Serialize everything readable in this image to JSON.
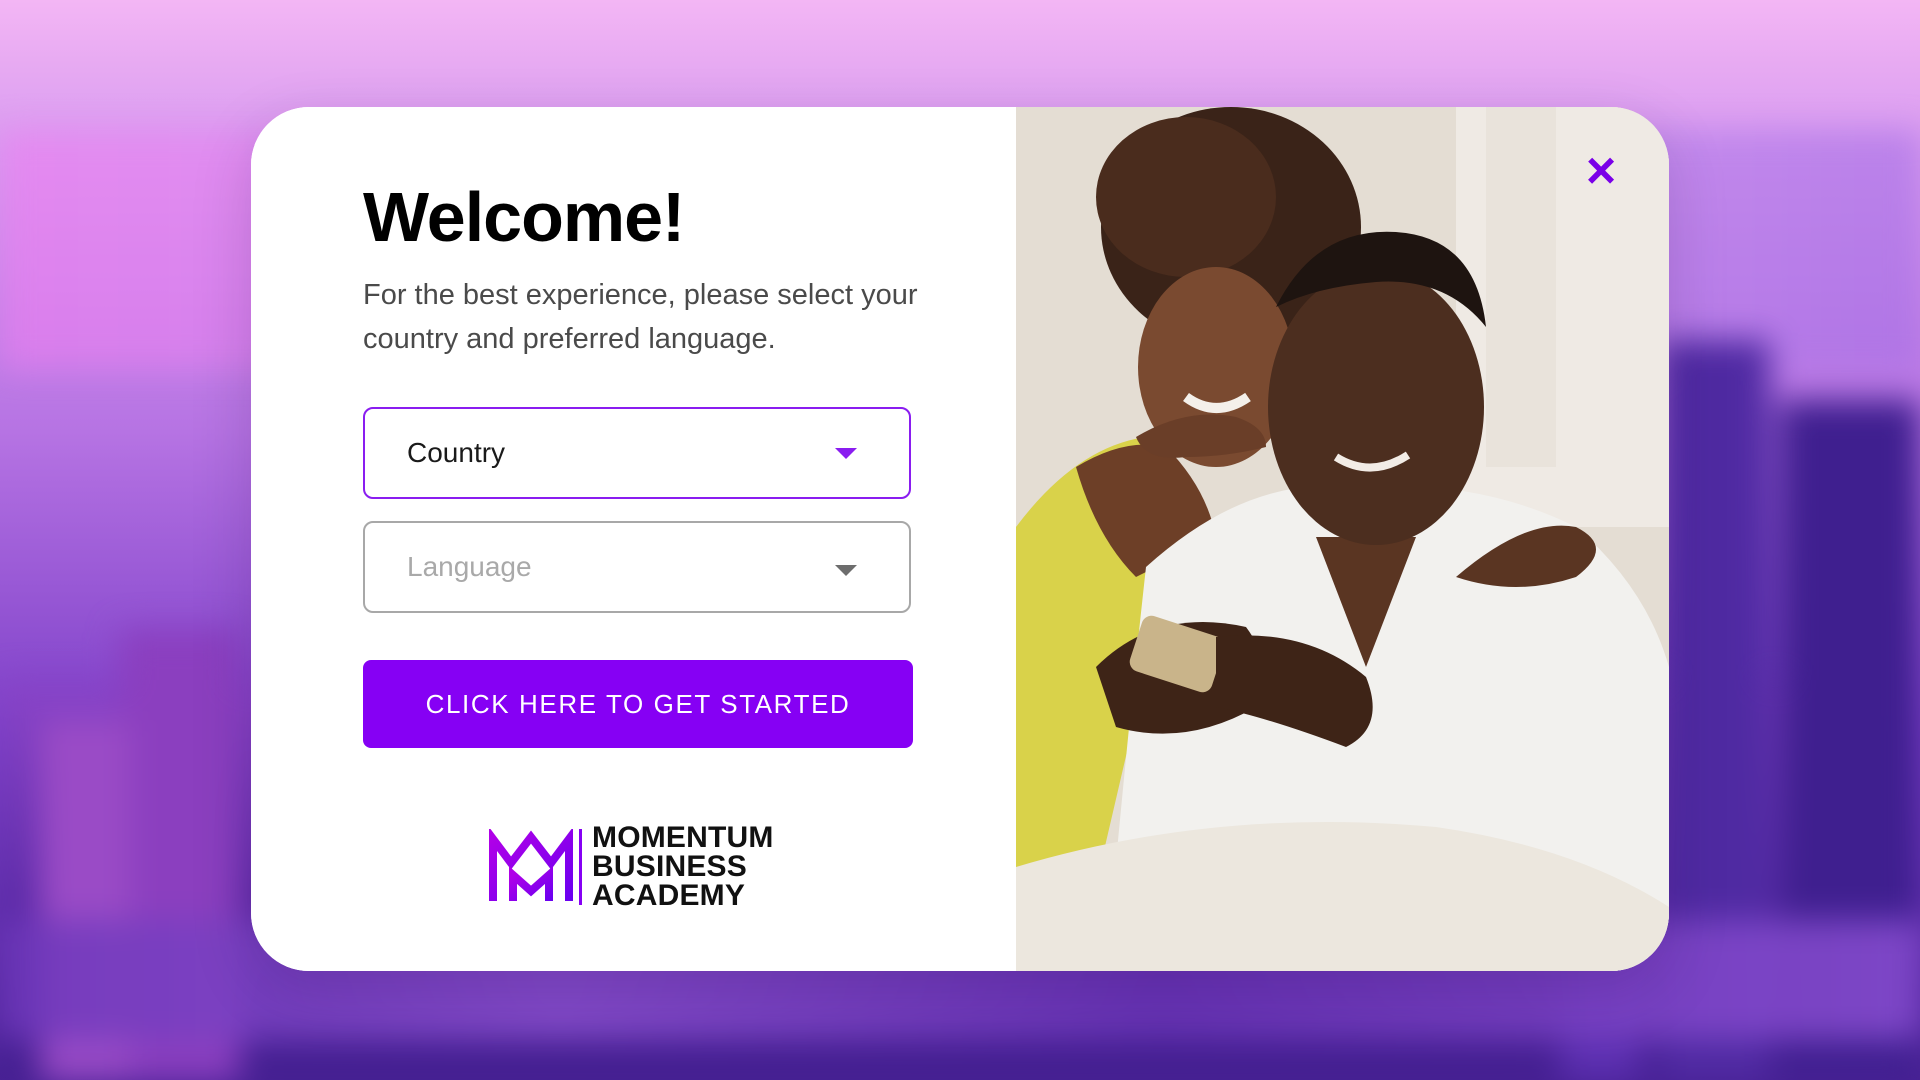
{
  "modal": {
    "title": "Welcome!",
    "subtitle": "For the best experience, please select your country and preferred language.",
    "country_select": {
      "value": "Country"
    },
    "language_select": {
      "placeholder": "Language"
    },
    "cta_label": "CLICK HERE TO GET STARTED",
    "close_symbol": "×"
  },
  "logo": {
    "line1": "MOMENTUM",
    "line2": "BUSINESS",
    "line3": "ACADEMY"
  },
  "colors": {
    "accent": "#8600f4",
    "close_icon": "#7a00e8"
  },
  "icons": {
    "close": "close-icon",
    "country_caret": "chevron-down-icon",
    "language_caret": "chevron-down-icon",
    "logo_mark": "mba-monogram-logo"
  }
}
